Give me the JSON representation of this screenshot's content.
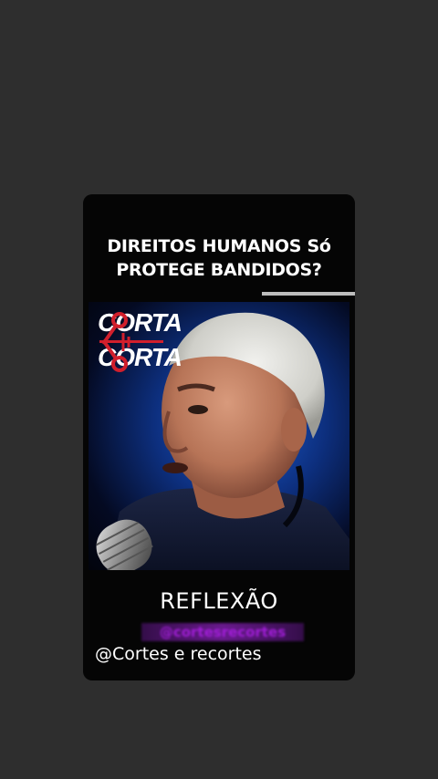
{
  "app": {
    "background_color": "#2e2e2e",
    "card_color": "#050505"
  },
  "post": {
    "headline_line1": "DIREITOS HUMANOS Só",
    "headline_line2": "PROTEGE BANDIDOS?",
    "progress_bar_color": "#bdbdbd",
    "video": {
      "logo_line1": "CORTA",
      "logo_line2": "CORTA",
      "logo_accent_color": "#d11f2c",
      "logo_icon": "scissors-icon",
      "backdrop_color": "#1c5fd6",
      "subject": "man speaking into microphone"
    },
    "caption": "REFLEXÃO",
    "watermark_text": "@cortesrecortes",
    "watermark_color": "#a21fd8",
    "handle": "@Cortes e recortes"
  }
}
